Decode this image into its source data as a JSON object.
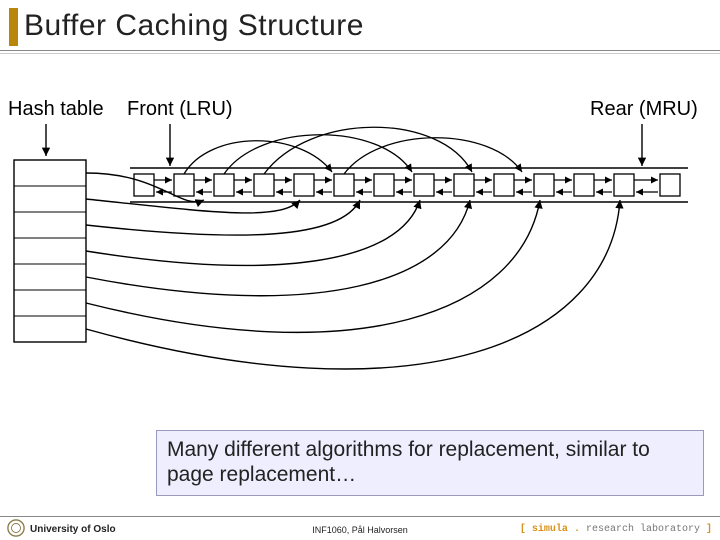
{
  "title": "Buffer Caching Structure",
  "diagram": {
    "labels": {
      "hash_table": "Hash table",
      "front": "Front (LRU)",
      "rear": "Rear (MRU)"
    },
    "hash_rows": 7,
    "buffer_count": 14,
    "mapping_note": "Hash table rows point into positions within a doubly-linked buffer list; list is ordered LRU (front) to MRU (rear)."
  },
  "callout": "Many different algorithms for replacement, similar to page replacement…",
  "footer": {
    "university": "University of Oslo",
    "course": "INF1060, Pål Halvorsen",
    "lab_prefix": "[ ",
    "lab_name": "simula",
    "lab_dot": " . ",
    "lab_rest": "research laboratory ",
    "lab_suffix": "]"
  }
}
